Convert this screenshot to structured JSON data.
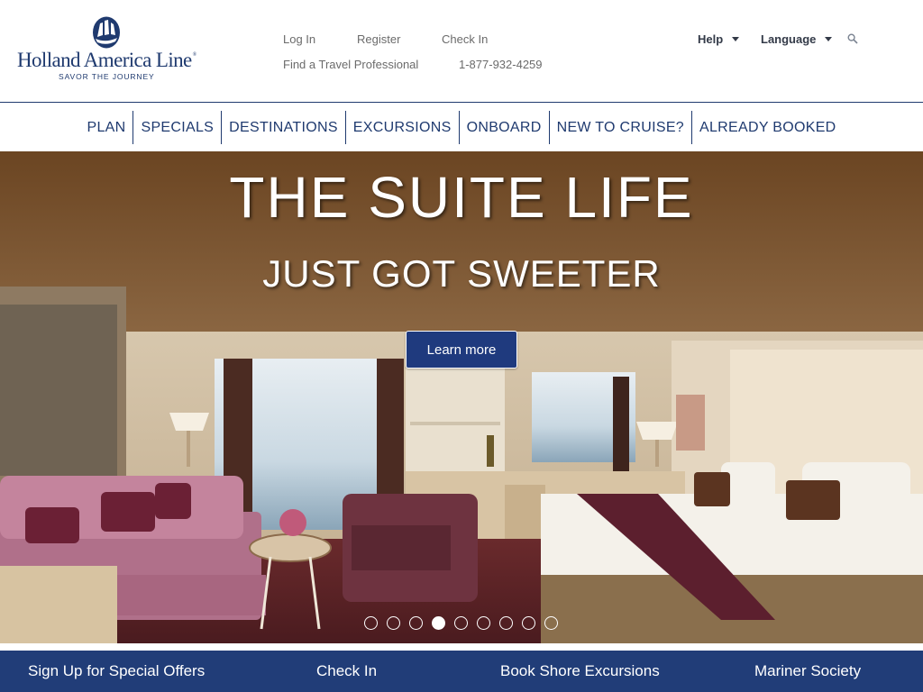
{
  "brand": {
    "name": "Holland America Line",
    "reg": "®",
    "tagline": "SAVOR THE JOURNEY",
    "color": "#1f3a6f"
  },
  "utility": {
    "login": "Log In",
    "register": "Register",
    "checkin": "Check In",
    "find_pro": "Find a Travel Professional",
    "phone": "1-877-932-4259",
    "help": "Help",
    "language": "Language",
    "search_icon": "search-icon"
  },
  "nav": {
    "items": [
      "PLAN",
      "SPECIALS",
      "DESTINATIONS",
      "EXCURSIONS",
      "ONBOARD",
      "NEW TO CRUISE?",
      "ALREADY BOOKED"
    ]
  },
  "hero": {
    "title": "THE SUITE LIFE",
    "subtitle": "JUST GOT SWEETER",
    "button": "Learn more",
    "slide_count": 9,
    "active_slide": 4
  },
  "footer": {
    "items": [
      "Sign Up for Special Offers",
      "Check In",
      "Book Shore Excursions",
      "Mariner Society"
    ],
    "bg_color": "#213d78"
  }
}
